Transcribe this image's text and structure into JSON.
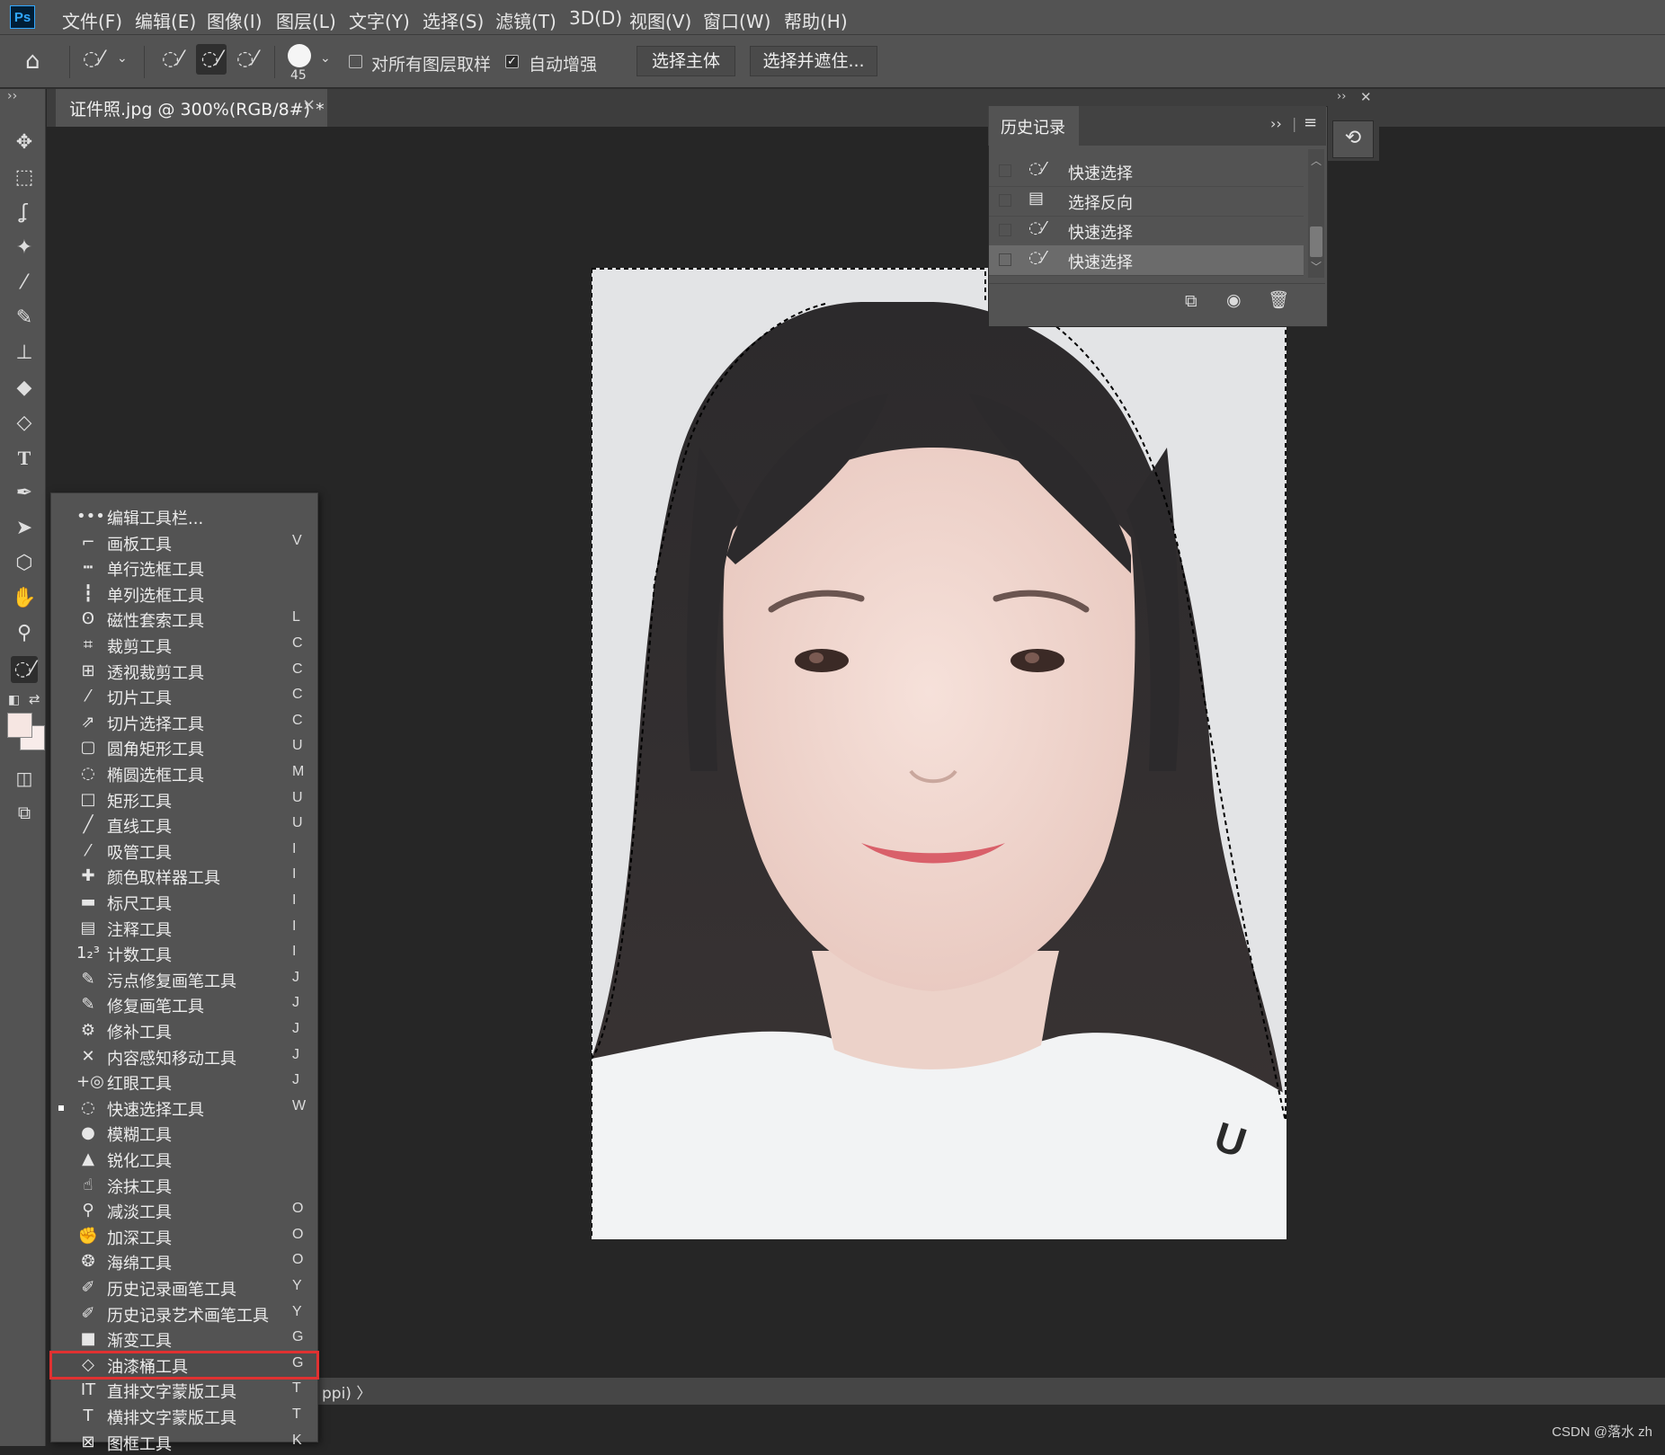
{
  "menubar": {
    "logo": "Ps",
    "items": [
      "文件(F)",
      "编辑(E)",
      "图像(I)",
      "图层(L)",
      "文字(Y)",
      "选择(S)",
      "滤镜(T)",
      "3D(D)",
      "视图(V)",
      "窗口(W)",
      "帮助(H)"
    ]
  },
  "options": {
    "brush_size": "45",
    "sample_all_label": "对所有图层取样",
    "sample_all_checked": false,
    "auto_enhance_label": "自动增强",
    "auto_enhance_checked": true,
    "select_subject": "选择主体",
    "select_and_mask": "选择并遮住..."
  },
  "document": {
    "tab_title": "证件照.jpg @ 300%(RGB/8#) *",
    "close": "×"
  },
  "status": {
    "text": "ppi) 〉"
  },
  "watermark": "CSDN @落水 zh",
  "flyout": {
    "items": [
      {
        "icon": "more-dots-icon",
        "glyph": "•••",
        "label": "编辑工具栏...",
        "key": ""
      },
      {
        "icon": "artboard-icon",
        "glyph": "⌐",
        "label": "画板工具",
        "key": "V"
      },
      {
        "icon": "single-row-marquee-icon",
        "glyph": "┅",
        "label": "单行选框工具",
        "key": ""
      },
      {
        "icon": "single-column-marquee-icon",
        "glyph": "┇",
        "label": "单列选框工具",
        "key": ""
      },
      {
        "icon": "magnetic-lasso-icon",
        "glyph": "ʘ",
        "label": "磁性套索工具",
        "key": "L"
      },
      {
        "icon": "crop-icon",
        "glyph": "⌗",
        "label": "裁剪工具",
        "key": "C"
      },
      {
        "icon": "perspective-crop-icon",
        "glyph": "⊞",
        "label": "透视裁剪工具",
        "key": "C"
      },
      {
        "icon": "slice-icon",
        "glyph": "⁄",
        "label": "切片工具",
        "key": "C"
      },
      {
        "icon": "slice-select-icon",
        "glyph": "⇗",
        "label": "切片选择工具",
        "key": "C"
      },
      {
        "icon": "rounded-rectangle-icon",
        "glyph": "▢",
        "label": "圆角矩形工具",
        "key": "U"
      },
      {
        "icon": "elliptical-marquee-icon",
        "glyph": "◌",
        "label": "椭圆选框工具",
        "key": "M"
      },
      {
        "icon": "rectangle-icon",
        "glyph": "□",
        "label": "矩形工具",
        "key": "U"
      },
      {
        "icon": "line-icon",
        "glyph": "╱",
        "label": "直线工具",
        "key": "U"
      },
      {
        "icon": "eyedropper-icon",
        "glyph": "⁄",
        "label": "吸管工具",
        "key": "I"
      },
      {
        "icon": "color-sampler-icon",
        "glyph": "✚",
        "label": "颜色取样器工具",
        "key": "I"
      },
      {
        "icon": "ruler-icon",
        "glyph": "▬",
        "label": "标尺工具",
        "key": "I"
      },
      {
        "icon": "note-icon",
        "glyph": "▤",
        "label": "注释工具",
        "key": "I"
      },
      {
        "icon": "count-icon",
        "glyph": "1₂³",
        "label": "计数工具",
        "key": "I"
      },
      {
        "icon": "spot-healing-icon",
        "glyph": "✎",
        "label": "污点修复画笔工具",
        "key": "J"
      },
      {
        "icon": "healing-brush-icon",
        "glyph": "✎",
        "label": "修复画笔工具",
        "key": "J"
      },
      {
        "icon": "patch-icon",
        "glyph": "⚙",
        "label": "修补工具",
        "key": "J"
      },
      {
        "icon": "content-aware-move-icon",
        "glyph": "✕",
        "label": "内容感知移动工具",
        "key": "J"
      },
      {
        "icon": "red-eye-icon",
        "glyph": "+◎",
        "label": "红眼工具",
        "key": "J"
      },
      {
        "icon": "quick-selection-icon",
        "glyph": "◌",
        "label": "快速选择工具",
        "key": "W",
        "current": true
      },
      {
        "icon": "blur-icon",
        "glyph": "●",
        "label": "模糊工具",
        "key": ""
      },
      {
        "icon": "sharpen-icon",
        "glyph": "▲",
        "label": "锐化工具",
        "key": ""
      },
      {
        "icon": "smudge-icon",
        "glyph": "☝",
        "label": "涂抹工具",
        "key": ""
      },
      {
        "icon": "dodge-icon",
        "glyph": "⚲",
        "label": "减淡工具",
        "key": "O"
      },
      {
        "icon": "burn-icon",
        "glyph": "✊",
        "label": "加深工具",
        "key": "O"
      },
      {
        "icon": "sponge-icon",
        "glyph": "❂",
        "label": "海绵工具",
        "key": "O"
      },
      {
        "icon": "history-brush-icon",
        "glyph": "✐",
        "label": "历史记录画笔工具",
        "key": "Y"
      },
      {
        "icon": "art-history-brush-icon",
        "glyph": "✐",
        "label": "历史记录艺术画笔工具",
        "key": "Y"
      },
      {
        "icon": "gradient-icon",
        "glyph": "■",
        "label": "渐变工具",
        "key": "G"
      },
      {
        "icon": "paint-bucket-icon",
        "glyph": "◇",
        "label": "油漆桶工具",
        "key": "G",
        "highlight": true
      },
      {
        "icon": "vertical-type-mask-icon",
        "glyph": "IT",
        "label": "直排文字蒙版工具",
        "key": "T"
      },
      {
        "icon": "horizontal-type-mask-icon",
        "glyph": "T",
        "label": "横排文字蒙版工具",
        "key": "T"
      },
      {
        "icon": "frame-icon",
        "glyph": "⊠",
        "label": "图框工具",
        "key": "K"
      }
    ]
  },
  "history": {
    "title": "历史记录",
    "rows": [
      {
        "icon": "quick-selection-icon",
        "label": "快速选择",
        "current": false
      },
      {
        "icon": "document-icon",
        "label": "选择反向",
        "current": false
      },
      {
        "icon": "quick-selection-icon",
        "label": "快速选择",
        "current": false
      },
      {
        "icon": "quick-selection-icon",
        "label": "快速选择",
        "current": true
      }
    ]
  },
  "colors": {
    "selection_highlight": "#e03131",
    "foreground": "#f6e6e2",
    "background": "#f8ecea"
  }
}
